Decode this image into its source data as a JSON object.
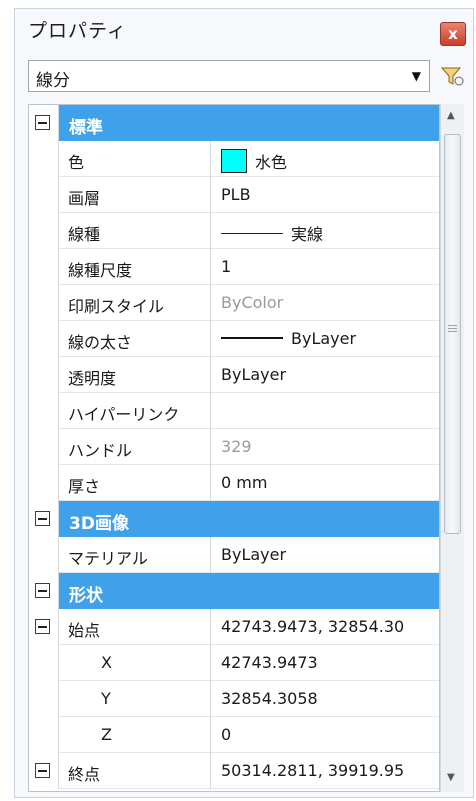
{
  "panel": {
    "title": "プロパティ",
    "close_label": "x",
    "object_type": "線分"
  },
  "categories": {
    "general": "標準",
    "visualization": "3D画像",
    "geometry": "形状"
  },
  "properties": {
    "color": {
      "name": "色",
      "value": "水色",
      "swatch": "#00ffff"
    },
    "layer": {
      "name": "画層",
      "value": "PLB"
    },
    "linetype": {
      "name": "線種",
      "value": "実線"
    },
    "linetype_scale": {
      "name": "線種尺度",
      "value": "1"
    },
    "plot_style": {
      "name": "印刷スタイル",
      "value": "ByColor"
    },
    "lineweight": {
      "name": "線の太さ",
      "value": "ByLayer"
    },
    "transparency": {
      "name": "透明度",
      "value": "ByLayer"
    },
    "hyperlink": {
      "name": "ハイパーリンク",
      "value": ""
    },
    "handle": {
      "name": "ハンドル",
      "value": "329"
    },
    "thickness": {
      "name": "厚さ",
      "value": "0 mm"
    },
    "material": {
      "name": "マテリアル",
      "value": "ByLayer"
    },
    "start_point": {
      "name": "始点",
      "value": "42743.9473, 32854.30"
    },
    "start_x": {
      "name": "X",
      "value": "42743.9473"
    },
    "start_y": {
      "name": "Y",
      "value": "32854.3058"
    },
    "start_z": {
      "name": "Z",
      "value": "0"
    },
    "end_point": {
      "name": "終点",
      "value": "50314.2811, 39919.95"
    }
  },
  "icons": {
    "close": "close-icon",
    "dropdown": "chevron-down-icon",
    "filter": "quick-select-filter-icon",
    "collapse": "minus-box-icon"
  }
}
